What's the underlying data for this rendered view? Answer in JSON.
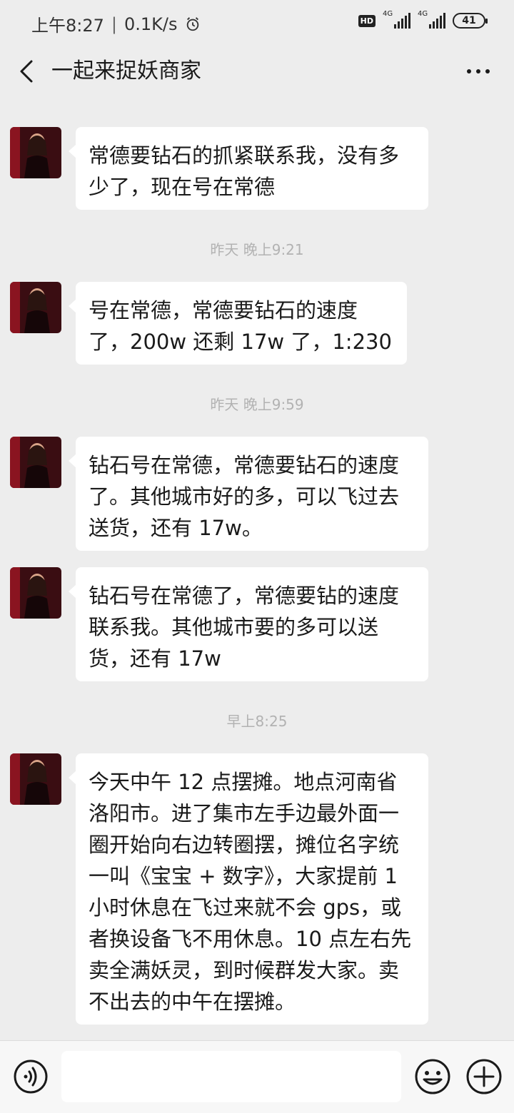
{
  "status_bar": {
    "time": "上午8:27",
    "separator": "|",
    "net_speed": "0.1K/s",
    "hd_label": "HD",
    "signal1_label": "4G",
    "signal2_label": "4G",
    "battery": "41"
  },
  "nav": {
    "title": "一起来捉妖商家"
  },
  "messages": [
    {
      "text": "常德要钻石的抓紧联系我，没有多少了，现在号在常德"
    },
    {
      "timestamp": "昨天 晚上9:21"
    },
    {
      "text": "号在常德，常德要钻石的速度了，200w 还剩 17w 了，1:230"
    },
    {
      "timestamp": "昨天 晚上9:59"
    },
    {
      "text": "钻石号在常德，常德要钻石的速度了。其他城市好的多，可以飞过去送货，还有 17w。"
    },
    {
      "text": "钻石号在常德了，常德要钻的速度联系我。其他城市要的多可以送货，还有 17w"
    },
    {
      "timestamp": "早上8:25"
    },
    {
      "text": "今天中午 12 点摆摊。地点河南省洛阳市。进了集市左手边最外面一圈开始向右边转圈摆，摊位名字统一叫《宝宝 + 数字》，大家提前 1 小时休息在飞过来就不会 gps，或者换设备飞不用休息。10 点左右先卖全满妖灵，到时候群发大家。卖不出去的中午在摆摊。"
    }
  ],
  "input": {
    "value": ""
  }
}
